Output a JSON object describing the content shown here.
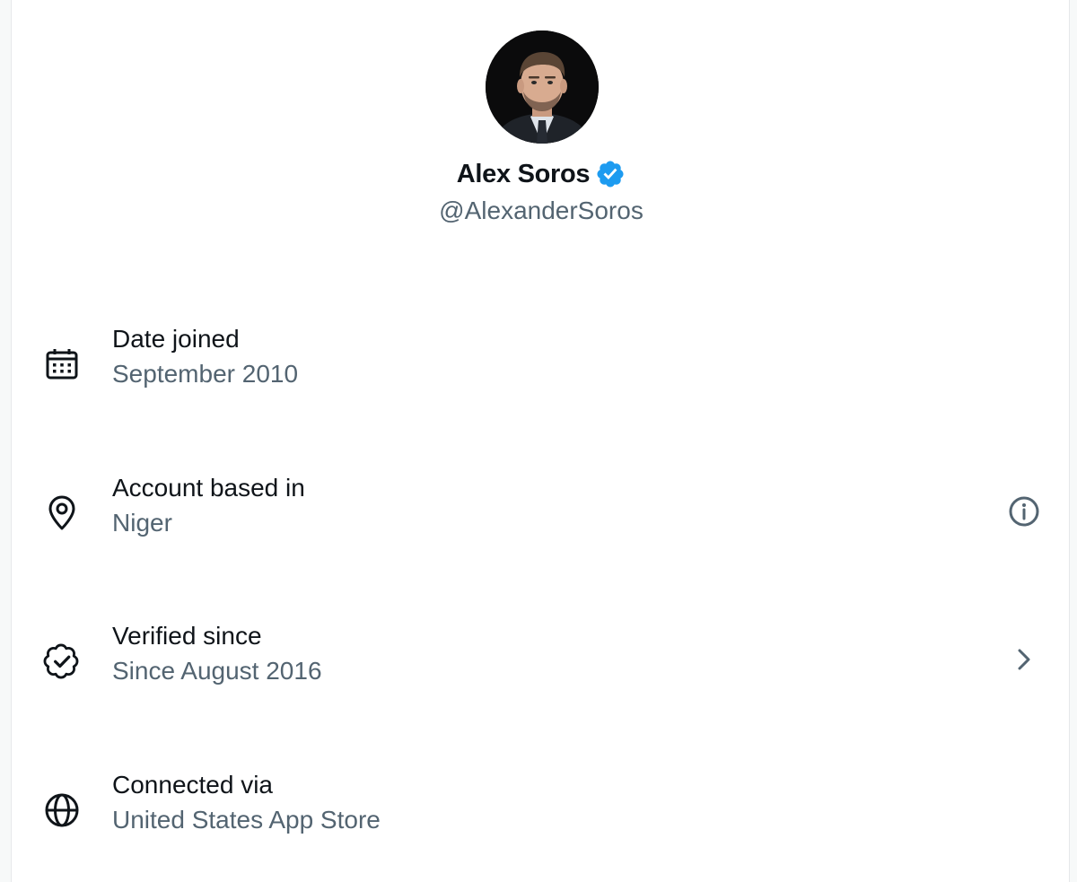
{
  "profile": {
    "display_name": "Alex Soros",
    "handle": "@AlexanderSoros",
    "verified_badge_icon": "verified-check-icon",
    "badge_color": "#1d9bf0"
  },
  "details": [
    {
      "icon": "calendar-icon",
      "label": "Date joined",
      "value": "September 2010",
      "action": null
    },
    {
      "icon": "location-pin-icon",
      "label": "Account based in",
      "value": "Niger",
      "action": "info-icon"
    },
    {
      "icon": "verified-badge-outline-icon",
      "label": "Verified since",
      "value": "Since August 2016",
      "action": "chevron-right-icon"
    },
    {
      "icon": "globe-icon",
      "label": "Connected via",
      "value": "United States App Store",
      "action": null
    }
  ],
  "colors": {
    "primary_text": "#0f1419",
    "secondary_text": "#536471",
    "background": "#ffffff"
  }
}
